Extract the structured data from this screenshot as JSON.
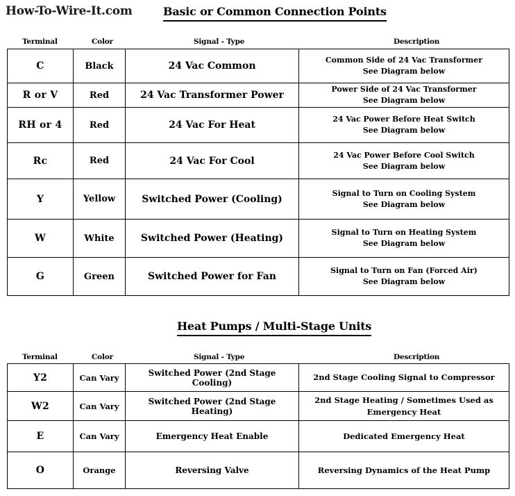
{
  "brand": "How-To-Wire-It.com",
  "sections": [
    {
      "title": "Basic  or Common Connection Points",
      "headers": {
        "terminal": "Terminal",
        "color": "Color",
        "signal": "Signal - Type",
        "description": "Description"
      },
      "rows": [
        {
          "terminal": "C",
          "color": "Black",
          "signal": "24 Vac Common",
          "desc_line1": "Common Side of 24 Vac Transformer",
          "desc_line2": "See Diagram below"
        },
        {
          "terminal": "R or V",
          "color": "Red",
          "signal": "24 Vac   Transformer Power",
          "desc_line1": "Power Side of 24 Vac Transformer",
          "desc_line2": "See Diagram below"
        },
        {
          "terminal": "RH  or 4",
          "color": "Red",
          "signal": "24 Vac   For Heat",
          "desc_line1": "24 Vac Power Before Heat Switch",
          "desc_line2": "See Diagram below"
        },
        {
          "terminal": "Rc",
          "color": "Red",
          "signal": "24 Vac   For Cool",
          "desc_line1": "24 Vac Power Before Cool Switch",
          "desc_line2": "See Diagram below"
        },
        {
          "terminal": "Y",
          "color": "Yellow",
          "signal": "Switched Power (Cooling)",
          "desc_line1": "Signal to Turn on Cooling System",
          "desc_line2": "See Diagram below"
        },
        {
          "terminal": "W",
          "color": "White",
          "signal": "Switched Power (Heating)",
          "desc_line1": "Signal to Turn on Heating System",
          "desc_line2": "See Diagram below"
        },
        {
          "terminal": "G",
          "color": "Green",
          "signal": "Switched Power for Fan",
          "desc_line1": "Signal to Turn on Fan (Forced Air)",
          "desc_line2": "See Diagram below"
        }
      ]
    },
    {
      "title": "Heat Pumps  /  Multi-Stage Units",
      "headers": {
        "terminal": "Terminal",
        "color": "Color",
        "signal": "Signal - Type",
        "description": "Description"
      },
      "rows": [
        {
          "terminal": "Y2",
          "color": "Can Vary",
          "signal": "Switched Power (2nd Stage Cooling)",
          "desc_line1": "2nd Stage Cooling Signal to Compressor",
          "desc_line2": ""
        },
        {
          "terminal": "W2",
          "color": "Can Vary",
          "signal": "Switched Power (2nd Stage Heating)",
          "desc_line1": "2nd Stage Heating / Sometimes Used as Emergency Heat",
          "desc_line2": ""
        },
        {
          "terminal": "E",
          "color": "Can Vary",
          "signal": "Emergency Heat Enable",
          "desc_line1": "Dedicated Emergency Heat",
          "desc_line2": ""
        },
        {
          "terminal": "O",
          "color": "Orange",
          "signal": "Reversing Valve",
          "desc_line1": "Reversing Dynamics of the Heat Pump",
          "desc_line2": ""
        }
      ]
    }
  ],
  "colors": {
    "text": "#000000",
    "background": "#ffffff",
    "border": "#000000"
  }
}
